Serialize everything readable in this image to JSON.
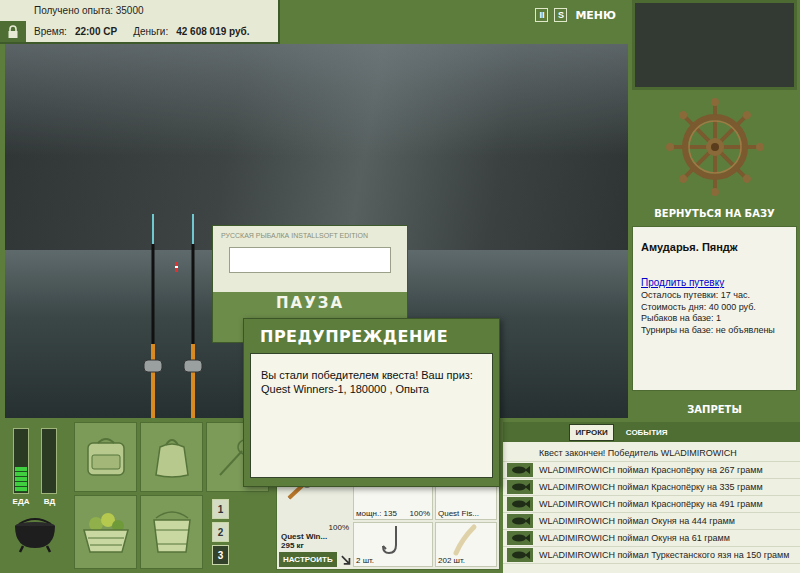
{
  "hud": {
    "experience": "Получено опыта: 35000",
    "time_label": "Время:",
    "time": "22:00 СР",
    "money_label": "Деньги:",
    "money": "42 608 019 руб."
  },
  "top_buttons": [
    "II",
    "S",
    "МЕНЮ"
  ],
  "pause": {
    "title": "РУССКАЯ РЫБАЛКА INSTALLSOFT EDITION",
    "label": "ПАУЗА"
  },
  "dialog": {
    "title": "ПРЕДУПРЕЖДЕНИЕ",
    "message": "Вы стали победителем квеста! Ваш приз: Quest Winners-1, 180000 , Опыта"
  },
  "base": {
    "return_button": "ВЕРНУТЬСЯ НА БАЗУ",
    "location": "Амударья. Пяндж",
    "extend_link": "Продлить путевку",
    "info": [
      "Осталось путевки: 17 час.",
      "Стоимость дня: 40 000 руб.",
      "Рыбаков на базе: 1",
      "Турниры на базе: не объявлены"
    ],
    "bans_button": "ЗАПРЕТЫ"
  },
  "meters": [
    {
      "label": "ЕДА",
      "level": 0.4
    },
    {
      "label": "ВД",
      "level": 0
    }
  ],
  "inventory": {
    "pages": [
      {
        "label": "1",
        "selected": false
      },
      {
        "label": "2",
        "selected": false
      },
      {
        "label": "3",
        "selected": true
      }
    ]
  },
  "tackle": {
    "rod": {
      "name": "Quest Win...",
      "weight": "295 кг",
      "condition": "100%"
    },
    "configure_button": "НАСТРОИТЬ",
    "reel": {
      "caption": "мощн.: 135",
      "condition": "100%"
    },
    "line": {
      "caption": "Quest Fis..."
    },
    "hook": {
      "caption": "2 шт."
    },
    "bait": {
      "caption": "202 шт."
    }
  },
  "events": {
    "tabs": [
      {
        "label": "ИГРОКИ",
        "selected": true
      },
      {
        "label": "СОБЫТИЯ",
        "selected": false
      }
    ],
    "entries": [
      {
        "text": "Квест закончен! Победитель WLADIMIROWICH",
        "kind": "notice"
      },
      {
        "text": "WLADIMIROWICH поймал Краснопёрку на 267 грамм",
        "kind": "catch"
      },
      {
        "text": "WLADIMIROWICH поймал Краснопёрку на 335 грамм",
        "kind": "catch"
      },
      {
        "text": "WLADIMIROWICH поймал Краснопёрку на 491 грамм",
        "kind": "catch"
      },
      {
        "text": "WLADIMIROWICH поймал Окуня на 444 грамм",
        "kind": "catch"
      },
      {
        "text": "WLADIMIROWICH поймал Окуня на 61 грамм",
        "kind": "catch"
      },
      {
        "text": "WLADIMIROWICH поймал Туркестанского язя на 150 грамм",
        "kind": "catch"
      }
    ]
  }
}
